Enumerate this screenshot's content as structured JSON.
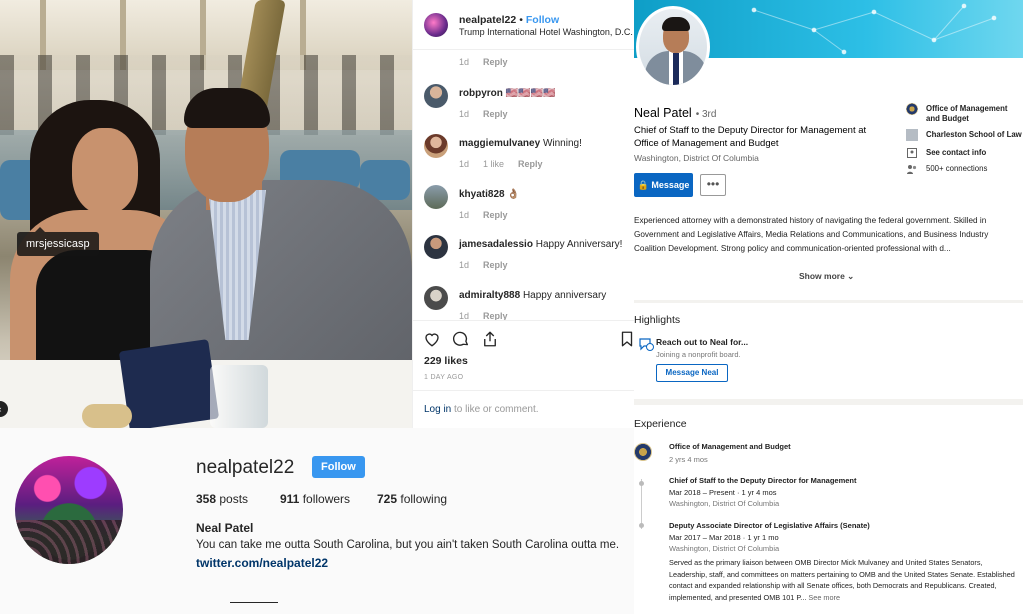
{
  "instagram": {
    "photo_tag": "mrsjessicasp",
    "post_header": {
      "username": "nealpatel22",
      "separator": "•",
      "follow_label": "Follow",
      "location": "Trump International Hotel Washington, D.C."
    },
    "header_meta": {
      "age": "1d",
      "reply": "Reply"
    },
    "comments": [
      {
        "username": "robpyron",
        "text": "🇺🇸🇺🇸🇺🇸🇺🇸",
        "age": "1d",
        "likes": "",
        "reply": "Reply"
      },
      {
        "username": "maggiemulvaney",
        "text": "Winning!",
        "age": "1d",
        "likes": "1 like",
        "reply": "Reply"
      },
      {
        "username": "khyati828",
        "text": "👌🏽",
        "age": "1d",
        "likes": "",
        "reply": "Reply"
      },
      {
        "username": "jamesadalessio",
        "text": "Happy Anniversary!",
        "age": "1d",
        "likes": "",
        "reply": "Reply"
      },
      {
        "username": "admiralty888",
        "text": "Happy anniversary",
        "age": "1d",
        "likes": "",
        "reply": "Reply"
      }
    ],
    "likes": "229 likes",
    "posted": "1 DAY AGO",
    "login_link": "Log in",
    "login_rest": " to like or comment.",
    "profile": {
      "username": "nealpatel22",
      "follow_label": "Follow",
      "posts_count": "358",
      "posts_label": " posts",
      "followers_count": "911",
      "followers_label": " followers",
      "following_count": "725",
      "following_label": " following",
      "full_name": "Neal Patel",
      "bio": "You can take me outta South Carolina, but you ain't taken South Carolina outta me.",
      "link": "twitter.com/nealpatel22"
    }
  },
  "linkedin": {
    "name": "Neal Patel",
    "degree": "• 3rd",
    "headline": "Chief of Staff to the Deputy Director for Management at Office of Management and Budget",
    "location": "Washington, District Of Columbia",
    "message_label": "Message",
    "more_label": "•••",
    "side": {
      "org": "Office of Management and Budget",
      "school": "Charleston School of Law",
      "contact": "See contact info",
      "connections": "500+ connections"
    },
    "about": "Experienced attorney with a demonstrated history of navigating the federal government. Skilled in Government and Legislative Affairs, Media Relations and Communications, and Business Industry Coalition Development. Strong policy and communication-oriented professional with d...",
    "show_more": "Show more ⌄",
    "highlights": {
      "title": "Highlights",
      "item_title": "Reach out to Neal for...",
      "item_sub": "Joining a nonprofit board.",
      "button": "Message Neal"
    },
    "experience": {
      "title": "Experience",
      "company": "Office of Management and Budget",
      "tenure": "2 yrs 4 mos",
      "roles": [
        {
          "title": "Chief of Staff to the Deputy Director for Management",
          "dates": "Mar 2018 – Present · 1 yr 4 mos",
          "location": "Washington, District Of Columbia"
        },
        {
          "title": "Deputy Associate Director of Legislative Affairs (Senate)",
          "dates": "Mar 2017 – Mar 2018 · 1 yr 1 mo",
          "location": "Washington, District Of Columbia"
        }
      ],
      "description": "Served as the primary liaison between OMB Director Mick Mulvaney and United States Senators, Leadership, staff, and committees on matters pertaining to OMB and the United States Senate. Established contact and expanded relationship with all Senate offices, both Democrats and Republicans. Created, implemented, and presented OMB 101 P...",
      "see_more": "See more"
    }
  },
  "colors": {
    "ig_blue": "#3897f0",
    "li_blue": "#0a66c2",
    "li_banner": "#2dbfe6"
  }
}
